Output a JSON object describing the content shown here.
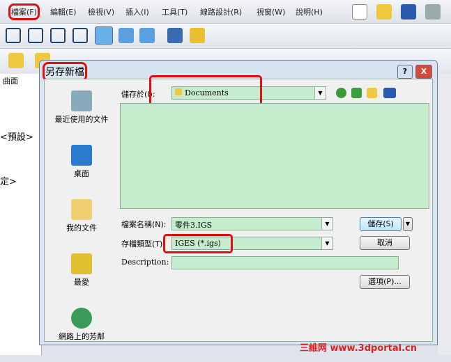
{
  "menu": [
    "檔案(F)",
    "編輯(E)",
    "檢視(V)",
    "插入(I)",
    "工具(T)",
    "線路設計(R)",
    "視窗(W)",
    "說明(H)"
  ],
  "left_panel": {
    "tab": "曲面",
    "text1": "<預設>",
    "text2": "定>"
  },
  "dialog": {
    "title": "另存新檔",
    "save_in_label": "儲存於(I):",
    "save_in_value": "Documents",
    "places": [
      "最近使用的文件",
      "桌面",
      "我的文件",
      "最愛",
      "網路上的芳鄰"
    ],
    "filename_label": "檔案名稱(N):",
    "filename_value": "零件3.IGS",
    "filetype_label": "存檔類型(T):",
    "filetype_value": "IGES (*.igs)",
    "description_label": "Description:",
    "description_value": "",
    "save_button": "儲存(S)",
    "cancel_button": "取消",
    "options_button": "選項(P)...",
    "help_button": "?",
    "close_button": "X"
  },
  "watermark": "三維网 www.3dportal.cn"
}
